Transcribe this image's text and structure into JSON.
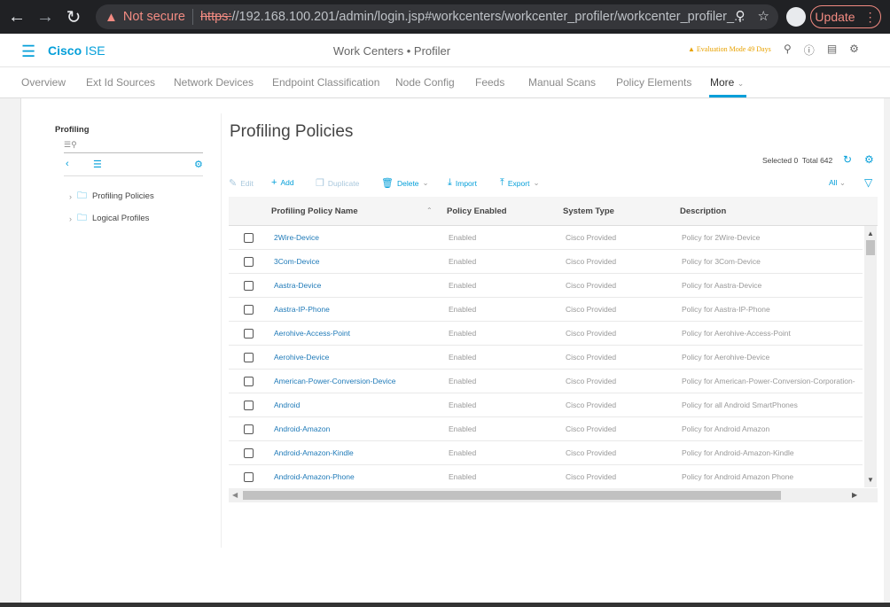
{
  "browser": {
    "not_secure": "Not secure",
    "url_scheme": "https:",
    "url_rest": "//192.168.100.201/admin/login.jsp#workcenters/workcenter_profiler/workcenter_profiler_...",
    "update_label": "Update"
  },
  "header": {
    "brand_cisco": "Cisco",
    "brand_ise": "ISE",
    "title": "Work Centers • Profiler",
    "eval_mode": "Evaluation Mode 49 Days"
  },
  "tabs": [
    {
      "label": "Overview"
    },
    {
      "label": "Ext Id Sources"
    },
    {
      "label": "Network Devices"
    },
    {
      "label": "Endpoint Classification"
    },
    {
      "label": "Node Config"
    },
    {
      "label": "Feeds"
    },
    {
      "label": "Manual Scans"
    },
    {
      "label": "Policy Elements"
    },
    {
      "label": "More"
    }
  ],
  "sidebar": {
    "title": "Profiling",
    "items": [
      {
        "label": "Profiling Policies"
      },
      {
        "label": "Logical Profiles"
      }
    ]
  },
  "main": {
    "title": "Profiling Policies",
    "selected_label": "Selected 0",
    "total_label": "Total 642",
    "filter_label": "All"
  },
  "toolbar": {
    "edit": "Edit",
    "add": "Add",
    "duplicate": "Duplicate",
    "delete": "Delete",
    "import": "Import",
    "export": "Export"
  },
  "table": {
    "columns": [
      "Profiling Policy Name",
      "Policy Enabled",
      "System Type",
      "Description"
    ],
    "rows": [
      {
        "name": "2Wire-Device",
        "enabled": "Enabled",
        "system": "Cisco Provided",
        "desc": "Policy for 2Wire-Device"
      },
      {
        "name": "3Com-Device",
        "enabled": "Enabled",
        "system": "Cisco Provided",
        "desc": "Policy for 3Com-Device"
      },
      {
        "name": "Aastra-Device",
        "enabled": "Enabled",
        "system": "Cisco Provided",
        "desc": "Policy for Aastra-Device"
      },
      {
        "name": "Aastra-IP-Phone",
        "enabled": "Enabled",
        "system": "Cisco Provided",
        "desc": "Policy for Aastra-IP-Phone"
      },
      {
        "name": "Aerohive-Access-Point",
        "enabled": "Enabled",
        "system": "Cisco Provided",
        "desc": "Policy for Aerohive-Access-Point"
      },
      {
        "name": "Aerohive-Device",
        "enabled": "Enabled",
        "system": "Cisco Provided",
        "desc": "Policy for Aerohive-Device"
      },
      {
        "name": "American-Power-Conversion-Device",
        "enabled": "Enabled",
        "system": "Cisco Provided",
        "desc": "Policy for American-Power-Conversion-Corporation-"
      },
      {
        "name": "Android",
        "enabled": "Enabled",
        "system": "Cisco Provided",
        "desc": "Policy for all Android SmartPhones"
      },
      {
        "name": "Android-Amazon",
        "enabled": "Enabled",
        "system": "Cisco Provided",
        "desc": "Policy for Android Amazon"
      },
      {
        "name": "Android-Amazon-Kindle",
        "enabled": "Enabled",
        "system": "Cisco Provided",
        "desc": "Policy for Android-Amazon-Kindle"
      },
      {
        "name": "Android-Amazon-Phone",
        "enabled": "Enabled",
        "system": "Cisco Provided",
        "desc": "Policy for Android Amazon Phone"
      }
    ]
  }
}
